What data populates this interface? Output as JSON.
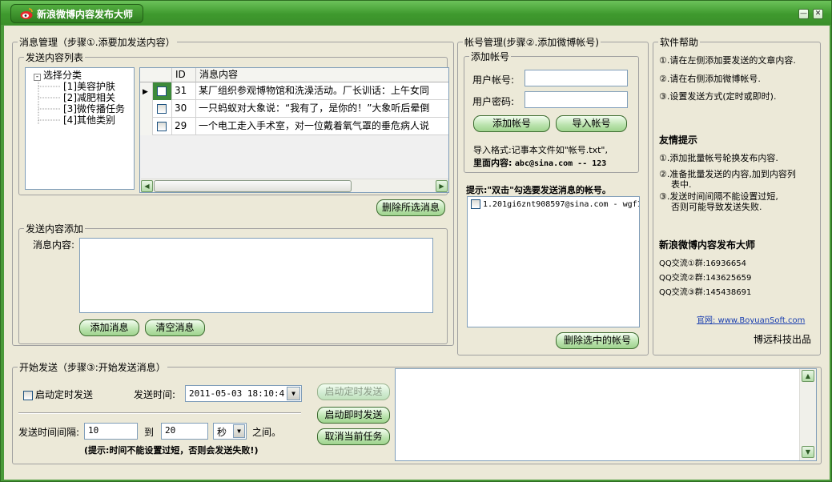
{
  "window": {
    "title": "新浪微博内容发布大师",
    "min": "—",
    "close": "✕"
  },
  "msg_mgmt": {
    "legend": "消息管理（步骤①.添要加发送内容）",
    "list_legend": "发送内容列表",
    "tree": {
      "root": "选择分类",
      "items": [
        "[1]美容护肤",
        "[2]减肥相关",
        "[3]微传播任务",
        "[4]其他类别"
      ]
    },
    "grid": {
      "col_id": "ID",
      "col_content": "消息内容",
      "rows": [
        {
          "id": "31",
          "content": "某厂组织参观博物馆和洗澡活动。厂长训话：上午女同"
        },
        {
          "id": "30",
          "content": "一只蚂蚁对大象说：“我有了，是你的！”大象听后晕倒"
        },
        {
          "id": "29",
          "content": "一个电工走入手术室，对一位戴着氧气罩的垂危病人说"
        }
      ]
    },
    "delete_selected": "删除所选消息",
    "add_legend": "发送内容添加",
    "content_label": "消息内容:",
    "content_value": "",
    "add_button": "添加消息",
    "clear_button": "清空消息"
  },
  "account": {
    "legend": "帐号管理(步骤②.添加微博帐号)",
    "add_legend": "添加帐号",
    "user_label": "用户帐号:",
    "user_value": "",
    "pass_label": "用户密码:",
    "pass_value": "",
    "add_button": "添加帐号",
    "import_button": "导入帐号",
    "import_hint1": "导入格式:记事本文件如\"帐号.txt\",",
    "import_hint2_label": "里面内容:",
    "import_hint2_value": "abc@sina.com -- 123",
    "tip": "提示:\"双击\"勾选要发送消息的帐号。",
    "accounts": [
      "1.201gi6znt908597@sina.com - wgf1"
    ],
    "delete_button": "删除选中的帐号"
  },
  "help": {
    "legend": "软件帮助",
    "lines": [
      "①.请在左侧添加要发送的文章内容.",
      "②.请在右侧添加微博帐号.",
      "③.设置发送方式(定时或即时)."
    ],
    "tips_title": "友情提示",
    "tips": [
      "①.添加批量帐号轮换发布内容.",
      "②.准备批量发送的内容,加到内容列",
      "表中.",
      "③.发送时间间隔不能设置过短,",
      "否则可能导致发送失败."
    ],
    "product": "新浪微博内容发布大师",
    "qq": [
      "QQ交流①群:16936654",
      "QQ交流②群:143625659",
      "QQ交流③群:145438691"
    ],
    "site": "官网: www.BoyuanSoft.com",
    "maker": "博远科技出品"
  },
  "send": {
    "legend": "开始发送（步骤③:开始发送消息）",
    "timed_label": "启动定时发送",
    "time_label": "发送时间:",
    "time_value": "2011-05-03 18:10:4",
    "interval_label": "发送时间间隔:",
    "interval_from": "10",
    "to_label": "到",
    "interval_to": "20",
    "unit": "秒",
    "between": "之间。",
    "warning": "(提示:时间不能设置过短，否则会发送失败!)",
    "start_timed": "启动定时发送",
    "start_now": "启动即时发送",
    "cancel": "取消当前任务",
    "log": ""
  }
}
